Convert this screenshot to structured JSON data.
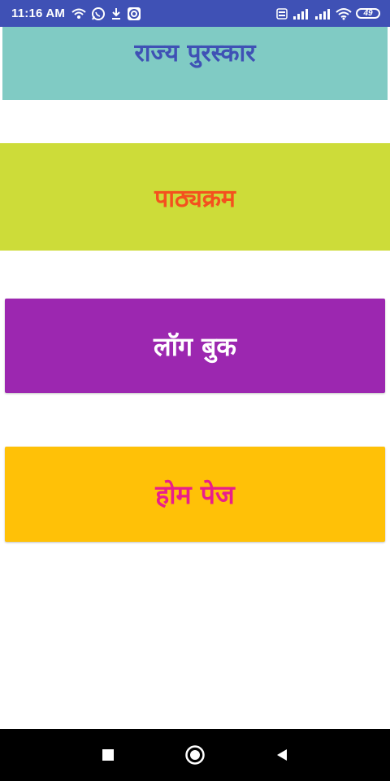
{
  "status_bar": {
    "time": "11:16 AM",
    "battery": "49",
    "background": "#3f51b5",
    "left_icons": [
      "wifi-calling-icon",
      "whatsapp-icon",
      "download-icon",
      "screen-record-icon"
    ],
    "right_icons": [
      "volte-icon",
      "signal-4g-icon",
      "signal-icon",
      "wifi-icon",
      "battery-icon"
    ]
  },
  "menu": {
    "state_award": {
      "label": "राज्य पुरस्कार",
      "bg": "#80cbc4",
      "color": "#3f51b5"
    },
    "syllabus": {
      "label": "पाठ्यक्रम",
      "bg": "#cddc39",
      "color": "#f4511e"
    },
    "log_book": {
      "label": "लॉग बुक",
      "bg": "#9c27b0",
      "color": "#ffffff"
    },
    "home_page": {
      "label": "होम पेज",
      "bg": "#ffc107",
      "color": "#e91e8c"
    }
  },
  "nav_bar": {
    "buttons": [
      "recents-square-icon",
      "home-circle-icon",
      "back-triangle-icon"
    ]
  }
}
